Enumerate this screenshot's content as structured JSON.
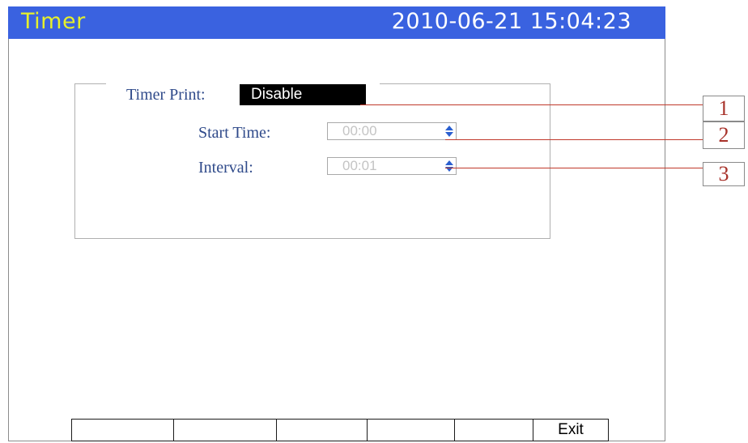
{
  "header": {
    "title": "Timer",
    "datetime": "2010-06-21 15:04:23"
  },
  "form": {
    "timer_print_label": "Timer Print:",
    "timer_print_value": "Disable",
    "start_time_label": "Start Time:",
    "start_time_value": "00:00",
    "interval_label": "Interval:",
    "interval_value": "00:01"
  },
  "callouts": [
    "1",
    "2",
    "3"
  ],
  "softkeys": [
    "",
    "",
    "",
    "",
    "",
    "Exit"
  ],
  "colors": {
    "titlebar": "#3a62e0",
    "title_text": "#e6f02a",
    "callout_line": "#c0392b",
    "label_text": "#2f4a8a"
  },
  "icons": {
    "spinner": "up-down-arrows-icon"
  }
}
